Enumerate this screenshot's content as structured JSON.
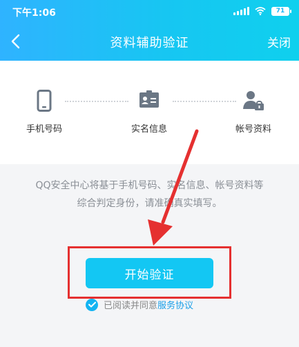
{
  "status_bar": {
    "time": "下午1:06",
    "battery": "71"
  },
  "header": {
    "title": "资料辅助验证",
    "close_label": "关闭"
  },
  "steps": [
    {
      "label": "手机号码",
      "icon": "phone-icon"
    },
    {
      "label": "实名信息",
      "icon": "id-card-icon"
    },
    {
      "label": "帐号资料",
      "icon": "account-profile-icon"
    }
  ],
  "description": {
    "line1": "QQ安全中心将基于手机号码、实名信息、帐号资料等",
    "line2": "综合判定身份，请准确真实填写。"
  },
  "start_button": {
    "label": "开始验证"
  },
  "agreement": {
    "prefix": "已阅读并同意",
    "link": "服务协议"
  },
  "colors": {
    "accent": "#13c7f3",
    "link": "#1a9fe8",
    "annotation": "#e53030"
  }
}
